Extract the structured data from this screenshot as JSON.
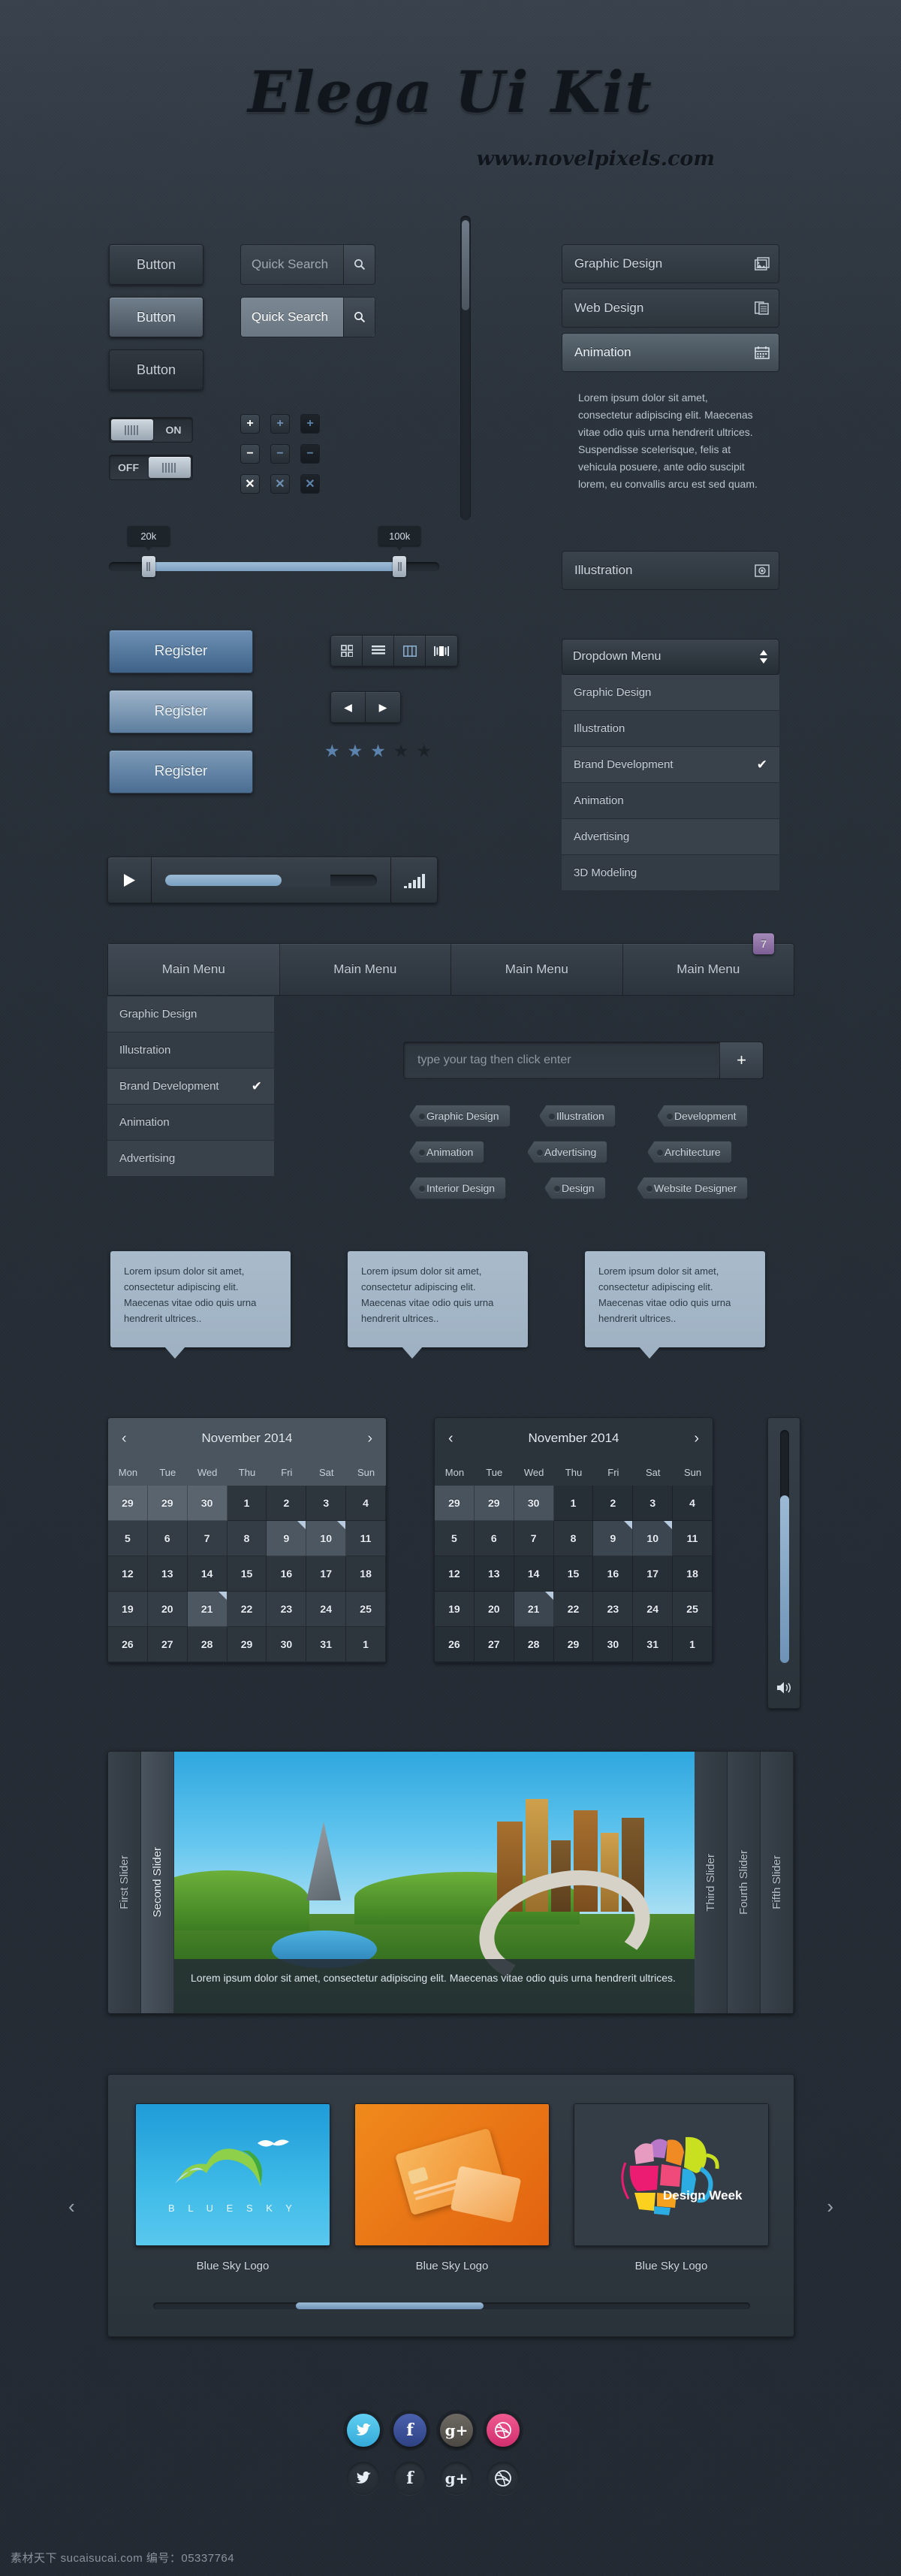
{
  "header": {
    "title": "Elega Ui Kit",
    "subtitle": "www.novelpixels.com"
  },
  "buttons": [
    {
      "label": "Button",
      "style": "dark"
    },
    {
      "label": "Button",
      "style": "light"
    },
    {
      "label": "Button",
      "style": "flat"
    }
  ],
  "search": [
    {
      "placeholder": "Quick Search",
      "icon": "search-icon",
      "style": "dark"
    },
    {
      "placeholder": "Quick Search",
      "icon": "search-icon",
      "style": "light"
    }
  ],
  "toggles": [
    {
      "label": "ON",
      "state": "on"
    },
    {
      "label": "OFF",
      "state": "off"
    }
  ],
  "icon_buttons": {
    "rows": [
      {
        "glyph": "+",
        "name": "plus-icon"
      },
      {
        "glyph": "−",
        "name": "minus-icon"
      },
      {
        "glyph": "✕",
        "name": "close-icon"
      }
    ]
  },
  "range_slider": {
    "min_label": "20k",
    "max_label": "100k",
    "min_pct": 12,
    "max_pct": 88
  },
  "register_buttons": [
    {
      "label": "Register"
    },
    {
      "label": "Register"
    },
    {
      "label": "Register"
    }
  ],
  "view_modes": [
    {
      "name": "grid-view-icon"
    },
    {
      "name": "list-view-icon"
    },
    {
      "name": "columns-view-icon"
    },
    {
      "name": "gallery-view-icon"
    }
  ],
  "pager": [
    {
      "name": "prev-arrow-icon",
      "glyph": "◀"
    },
    {
      "name": "next-arrow-icon",
      "glyph": "▶"
    }
  ],
  "rating": {
    "filled": 3,
    "total": 5
  },
  "player": {
    "play_icon": "play-icon",
    "progress_pct": 55,
    "buffer_pct": 78,
    "volume_icon": "volume-bars-icon"
  },
  "accordion": {
    "items": [
      {
        "label": "Graphic Design",
        "icon": "image-icon",
        "active": false
      },
      {
        "label": "Web Design",
        "icon": "documents-icon",
        "active": true
      },
      {
        "label": "Animation",
        "icon": "calendar-icon",
        "active": true
      },
      {
        "label": "Illustration",
        "icon": "camera-icon",
        "active": false
      }
    ],
    "body": "Lorem ipsum dolor sit amet, consectetur adipiscing elit. Maecenas vitae odio quis urna hendrerit ultrices. Suspendisse scelerisque, felis at vehicula posuere, ante odio suscipit lorem, eu convallis arcu est sed quam."
  },
  "dropdown": {
    "label": "Dropdown Menu",
    "options": [
      {
        "label": "Graphic Design",
        "checked": false
      },
      {
        "label": "Illustration",
        "checked": false
      },
      {
        "label": "Brand Development",
        "checked": true
      },
      {
        "label": "Animation",
        "checked": false
      },
      {
        "label": "Advertising",
        "checked": false
      },
      {
        "label": "3D Modeling",
        "checked": false
      }
    ]
  },
  "tabs": [
    {
      "label": "Main Menu",
      "active": true,
      "badge": null
    },
    {
      "label": "Main Menu",
      "active": false,
      "badge": null
    },
    {
      "label": "Main Menu",
      "active": false,
      "badge": null
    },
    {
      "label": "Main Menu",
      "active": false,
      "badge": "7"
    }
  ],
  "tab_menu": [
    {
      "label": "Graphic Design",
      "checked": false
    },
    {
      "label": "Illustration",
      "checked": false
    },
    {
      "label": "Brand Development",
      "checked": true
    },
    {
      "label": "Animation",
      "checked": false
    },
    {
      "label": "Advertising",
      "checked": false
    }
  ],
  "tag_input": {
    "placeholder": "type your tag then click enter",
    "add_icon": "plus-icon"
  },
  "tags": [
    "Graphic Design",
    "Illustration",
    "Development",
    "Animation",
    "Advertising",
    "Architecture",
    "Interior Design",
    "Design",
    "Website Designer"
  ],
  "tooltips": [
    "Lorem ipsum dolor sit amet, consectetur adipiscing elit. Maecenas vitae odio quis urna hendrerit ultrices..",
    "Lorem ipsum dolor sit amet, consectetur adipiscing elit. Maecenas vitae odio quis urna hendrerit ultrices..",
    "Lorem ipsum dolor sit amet, consectetur adipiscing elit. Maecenas vitae odio quis urna hendrerit ultrices.."
  ],
  "calendar": {
    "title": "November 2014",
    "prev_icon": "chevron-left-icon",
    "next_icon": "chevron-right-icon",
    "day_names": [
      "Mon",
      "Tue",
      "Wed",
      "Thu",
      "Fri",
      "Sat",
      "Sun"
    ],
    "weeks": [
      [
        {
          "d": "29",
          "m": true
        },
        {
          "d": "29",
          "m": true
        },
        {
          "d": "30",
          "m": true
        },
        {
          "d": "1"
        },
        {
          "d": "2"
        },
        {
          "d": "3"
        },
        {
          "d": "4"
        }
      ],
      [
        {
          "d": "5"
        },
        {
          "d": "6"
        },
        {
          "d": "7"
        },
        {
          "d": "8"
        },
        {
          "d": "9",
          "hl": true,
          "mk": true
        },
        {
          "d": "10",
          "hl": true,
          "mk": true
        },
        {
          "d": "11"
        }
      ],
      [
        {
          "d": "12"
        },
        {
          "d": "13"
        },
        {
          "d": "14"
        },
        {
          "d": "15"
        },
        {
          "d": "16"
        },
        {
          "d": "17"
        },
        {
          "d": "18"
        }
      ],
      [
        {
          "d": "19"
        },
        {
          "d": "20"
        },
        {
          "d": "21",
          "hl": true,
          "mk": true
        },
        {
          "d": "22"
        },
        {
          "d": "23"
        },
        {
          "d": "24"
        },
        {
          "d": "25"
        }
      ],
      [
        {
          "d": "26"
        },
        {
          "d": "27"
        },
        {
          "d": "28"
        },
        {
          "d": "29"
        },
        {
          "d": "30"
        },
        {
          "d": "31"
        },
        {
          "d": "1"
        }
      ]
    ]
  },
  "volume_vertical": {
    "level_pct": 72,
    "icon": "speaker-icon"
  },
  "image_slider": {
    "tabs_left": [
      {
        "label": "First Slider",
        "active": false
      },
      {
        "label": "Second Slider",
        "active": true
      }
    ],
    "tabs_right": [
      {
        "label": "Third Slider",
        "active": false
      },
      {
        "label": "Fourth Slider",
        "active": false
      },
      {
        "label": "Fifth Slider",
        "active": false
      }
    ],
    "caption": "Lorem ipsum dolor sit amet, consectetur adipiscing elit. Maecenas vitae odio quis urna hendrerit ultrices."
  },
  "carousel": {
    "prev_icon": "chevron-left-icon",
    "next_icon": "chevron-right-icon",
    "cards": [
      {
        "caption": "Blue Sky Logo",
        "logo_text": "B L U E   S K Y",
        "theme": "blue-sky"
      },
      {
        "caption": "Blue Sky Logo",
        "logo_text": "",
        "theme": "orange-card"
      },
      {
        "caption": "Blue Sky Logo",
        "logo_text": "Design Week",
        "theme": "design-week"
      }
    ]
  },
  "social": {
    "colored": [
      {
        "name": "twitter-icon",
        "glyph": "ᵗ",
        "color": "#46c0ea"
      },
      {
        "name": "facebook-icon",
        "glyph": "f",
        "color": "#3a4f98"
      },
      {
        "name": "googleplus-icon",
        "glyph": "g+",
        "color": "#5d5a55"
      },
      {
        "name": "dribbble-icon",
        "glyph": "◌",
        "color": "#e0457f"
      }
    ],
    "dark": [
      {
        "name": "twitter-icon",
        "glyph": "ᵗ"
      },
      {
        "name": "facebook-icon",
        "glyph": "f"
      },
      {
        "name": "googleplus-icon",
        "glyph": "g+"
      },
      {
        "name": "dribbble-icon",
        "glyph": "◌"
      }
    ]
  },
  "watermark": "素材天下 sucaisucai.com  编号：05337764",
  "colors": {
    "accent": "#7da0c2",
    "bg": "#2b333b",
    "badge": "#7c5f95",
    "twitter": "#46c0ea",
    "facebook": "#3a4f98",
    "googleplus": "#5d5a55",
    "dribbble": "#e0457f"
  }
}
